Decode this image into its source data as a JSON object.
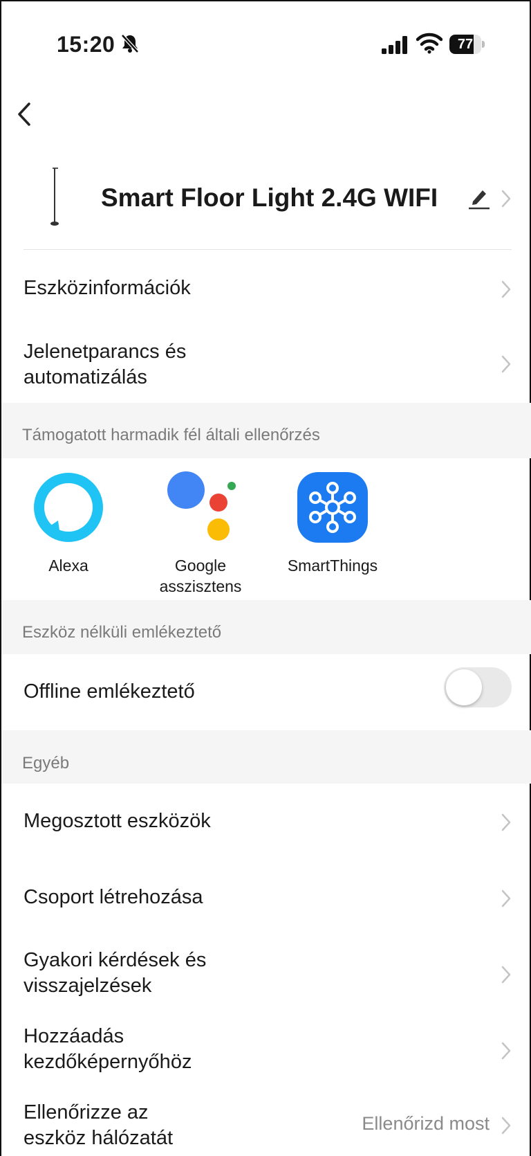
{
  "status_bar": {
    "time": "15:20",
    "battery": "77",
    "icons": [
      "bell-slash-icon",
      "signal-icon",
      "wifi-icon",
      "battery-icon"
    ]
  },
  "device": {
    "name": "Smart Floor Light 2.4G WIFI"
  },
  "rows_top": [
    {
      "label": "Eszközinformációk"
    },
    {
      "label": "Jelenetparancs és\nautomatizálás"
    }
  ],
  "sections": {
    "third_party": "Támogatott harmadik fél általi ellenőrzés",
    "offline": "Eszköz nélküli emlékeztető",
    "other": "Egyéb"
  },
  "third_party": [
    {
      "label": "Alexa",
      "icon": "alexa-icon"
    },
    {
      "label": "Google\nasszisztens",
      "icon": "google-assistant-icon"
    },
    {
      "label": "SmartThings",
      "icon": "smartthings-icon"
    }
  ],
  "offline_row": {
    "label": "Offline emlékeztető",
    "enabled": false
  },
  "rows_other": [
    {
      "label": "Megosztott eszközök"
    },
    {
      "label": "Csoport létrehozása"
    },
    {
      "label": "Gyakori kérdések és\nvisszajelzések"
    },
    {
      "label": "Hozzáadás\nkezdőképernyőhöz"
    },
    {
      "label": "Ellenőrizze az\neszköz hálózatát",
      "value": "Ellenőrizd most"
    }
  ],
  "colors": {
    "section_bg": "#f5f5f5",
    "alexa": "#1fc4f4",
    "smartthings": "#1c7bf0",
    "google_blue": "#4285f4",
    "google_red": "#ea4335",
    "google_yellow": "#fbbc05",
    "google_green": "#34a853"
  }
}
